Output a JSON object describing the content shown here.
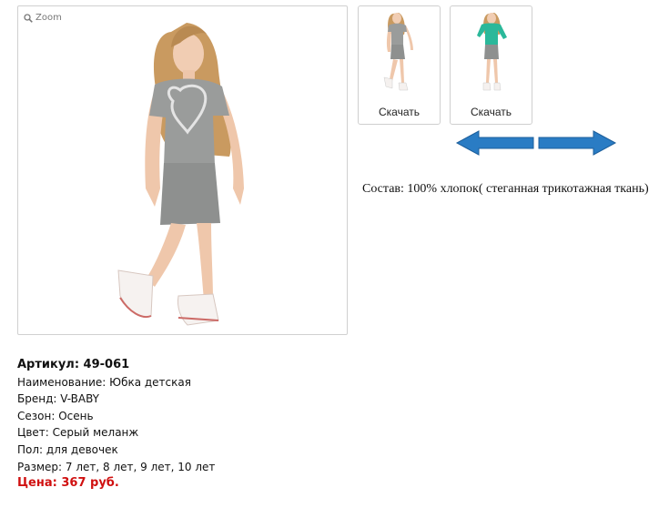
{
  "gallery": {
    "zoom_label": "Zoom",
    "thumbnails": [
      {
        "download_label": "Скачать",
        "top_color": "#9a9c9b",
        "skirt_color": "#8e908f"
      },
      {
        "download_label": "Скачать",
        "top_color": "#2bb89a",
        "skirt_color": "#8e908f"
      }
    ],
    "main_top_color": "#9a9c9b",
    "main_skirt_color": "#8e908f"
  },
  "composition_text": "Состав: 100% хлопок( стеганная трикотажная ткань)",
  "arrow_color": "#2a7cc4",
  "product": {
    "article": "Артикул: 49-061",
    "name": "Наименование: Юбка детская",
    "brand": "Бренд: V-BABY",
    "season": "Сезон: Осень",
    "color": "Цвет: Серый меланж",
    "gender": "Пол: для девочек",
    "sizes": "Размер: 7 лет, 8 лет, 9 лет, 10 лет",
    "price": "Цена: 367 руб.",
    "price_color": "#d01010"
  }
}
